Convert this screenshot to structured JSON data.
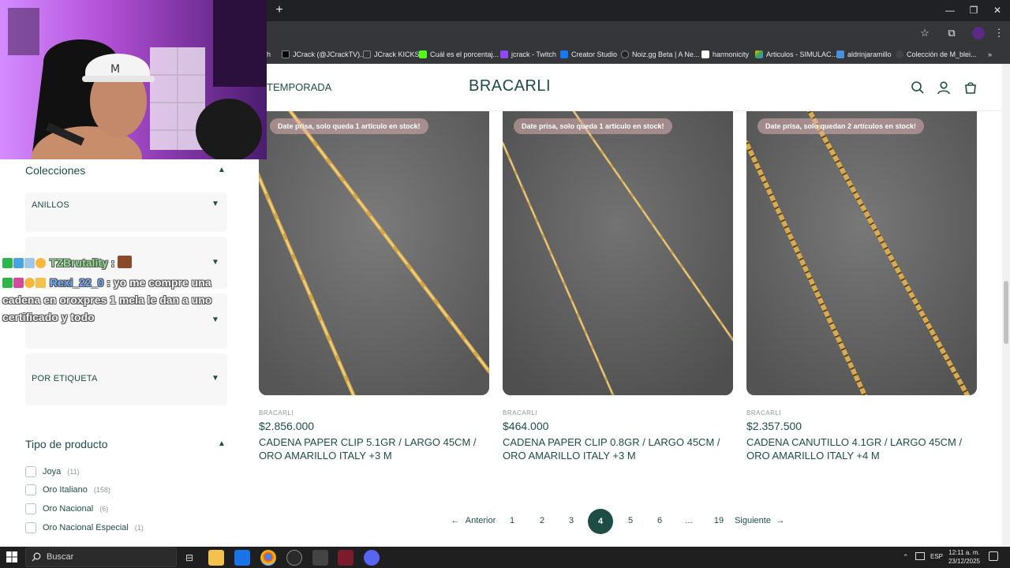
{
  "browser": {
    "new_tab_symbol": "+",
    "window_controls": {
      "minimize": "—",
      "restore": "❐",
      "close": "✕"
    },
    "bookmarks": [
      {
        "label": "h",
        "color": "#9146ff"
      },
      {
        "label": "JCrack (@JCrackTV)...",
        "color": "#000000"
      },
      {
        "label": "JCrack KICKS",
        "color": "#111111"
      },
      {
        "label": "Cuál es el porcentaj...",
        "color": "#53fc18"
      },
      {
        "label": "jcrack - Twitch",
        "color": "#9146ff"
      },
      {
        "label": "Creator Studio",
        "color": "#1877f2"
      },
      {
        "label": "Noiz.gg Beta | A Ne...",
        "color": "#222222"
      },
      {
        "label": "harmonicity",
        "color": "#ffffff"
      },
      {
        "label": "Articulos - SIMULAC...",
        "color": "#34a853"
      },
      {
        "label": "aldrinjaramillo",
        "color": "#4a90d9"
      },
      {
        "label": "Colección de M_blei...",
        "color": "#444444"
      }
    ],
    "overflow_symbol": "»"
  },
  "header": {
    "nav_item": "TEMPORADA",
    "brand": "BRACARLI"
  },
  "sidebar": {
    "colecciones_title": "Colecciones",
    "collections": [
      {
        "label": "ANILLOS"
      },
      {
        "label": ""
      },
      {
        "label": ""
      },
      {
        "label": "POR ETIQUETA"
      }
    ],
    "tipo_title": "Tipo de producto",
    "tipos": [
      {
        "label": "Joya",
        "count": "(11)"
      },
      {
        "label": "Oro Italiano",
        "count": "(158)"
      },
      {
        "label": "Oro Nacional",
        "count": "(6)"
      },
      {
        "label": "Oro Nacional Especial",
        "count": "(1)"
      }
    ]
  },
  "products": [
    {
      "badge": "Date prisa, solo queda 1 artículo en stock!",
      "vendor": "BRACARLI",
      "price": "$2.856.000",
      "name": "CADENA PAPER CLIP 5.1GR / LARGO 45CM / ORO AMARILLO ITALY +3 M"
    },
    {
      "badge": "Date prisa, solo queda 1 artículo en stock!",
      "vendor": "BRACARLI",
      "price": "$464.000",
      "name": "CADENA PAPER CLIP 0.8GR / LARGO 45CM / ORO AMARILLO ITALY +3 M"
    },
    {
      "badge": "Date prisa, solo quedan 2 artículos en stock!",
      "vendor": "BRACARLI",
      "price": "$2.357.500",
      "name": "CADENA CANUTILLO 4.1GR / LARGO 45CM / ORO AMARILLO ITALY +4 M"
    }
  ],
  "pagination": {
    "prev": "Anterior",
    "pages": [
      "1",
      "2",
      "3",
      "4",
      "5",
      "6",
      "...",
      "19"
    ],
    "current": "4",
    "next": "Siguiente"
  },
  "chat": [
    {
      "user": "TZBrutality",
      "sep": " :",
      "message": ""
    },
    {
      "user": "Rexi_22_0",
      "sep": " :",
      "message": " yo me compre una"
    },
    {
      "user": "",
      "sep": "",
      "message": "cadena en oroxpres 1 mela le dan a uno"
    },
    {
      "user": "",
      "sep": "",
      "message": "certificado y todo"
    }
  ],
  "taskbar": {
    "search_label": "Buscar",
    "language": "ESP",
    "time": "12:11 a. m.",
    "date": "23/12/2025"
  },
  "colors": {
    "brand_green": "#1d4d45",
    "badge_pink": "#ddb0b0",
    "gold": "#d4a64a"
  }
}
